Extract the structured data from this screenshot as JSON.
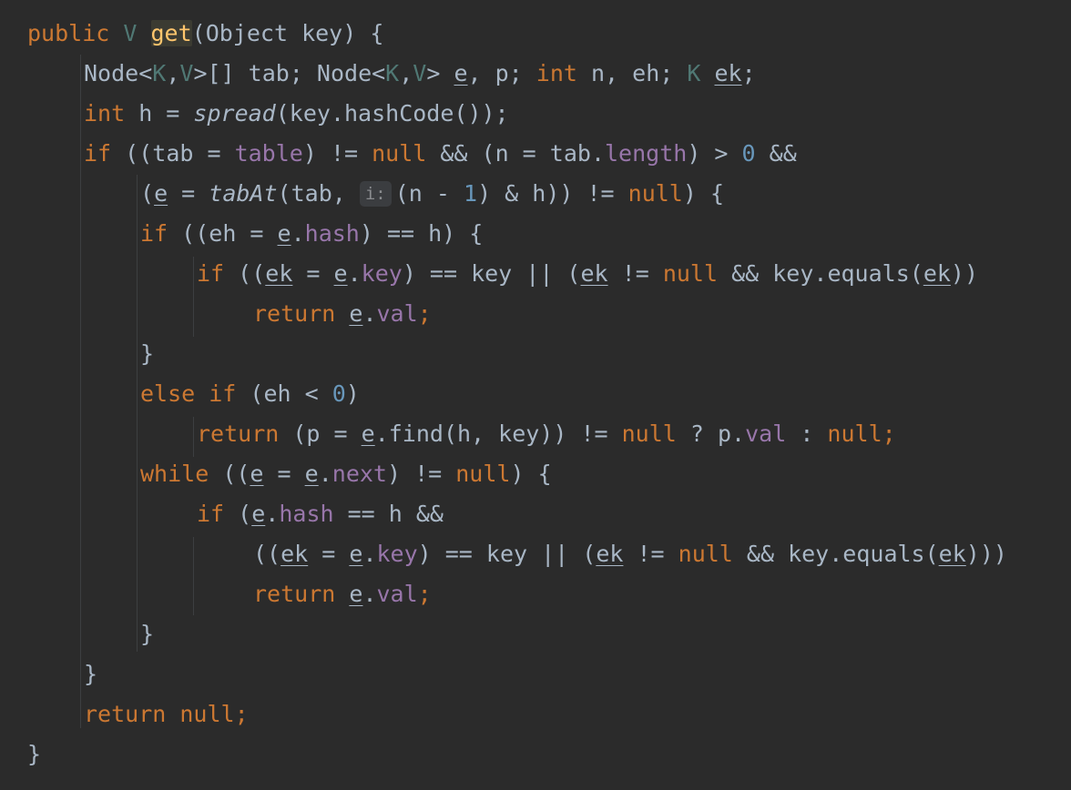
{
  "editor": {
    "language": "Java",
    "indent_spaces": 4,
    "gutter_char_offset": 0,
    "theme_colors": {
      "background": "#2b2b2b",
      "keyword": "#cc7832",
      "identifier": "#a9b7c6",
      "type_parameter": "#507874",
      "field": "#9876aa",
      "number": "#6897bb",
      "method_declaration": "#ffc66d",
      "inlay_hint_bg": "#3b3d40",
      "indent_guide": "#3d3f41"
    },
    "lines": [
      {
        "indent": 0,
        "tokens": [
          {
            "t": "public",
            "c": "kw"
          },
          {
            "t": " "
          },
          {
            "t": "V",
            "c": "tp"
          },
          {
            "t": " "
          },
          {
            "t": "get",
            "c": "hl"
          },
          {
            "t": "(Object key) {"
          }
        ]
      },
      {
        "indent": 1,
        "tokens": [
          {
            "t": "Node<"
          },
          {
            "t": "K",
            "c": "tp"
          },
          {
            "t": ","
          },
          {
            "t": "V",
            "c": "tp"
          },
          {
            "t": ">[] tab; Node<"
          },
          {
            "t": "K",
            "c": "tp"
          },
          {
            "t": ","
          },
          {
            "t": "V",
            "c": "tp"
          },
          {
            "t": "> "
          },
          {
            "t": "e",
            "c": "ul"
          },
          {
            "t": ", p; "
          },
          {
            "t": "int",
            "c": "kw"
          },
          {
            "t": " n, eh; "
          },
          {
            "t": "K",
            "c": "tp"
          },
          {
            "t": " "
          },
          {
            "t": "ek",
            "c": "ul"
          },
          {
            "t": ";"
          }
        ]
      },
      {
        "indent": 1,
        "tokens": [
          {
            "t": "int",
            "c": "kw"
          },
          {
            "t": " h = "
          },
          {
            "t": "spread",
            "c": "it"
          },
          {
            "t": "(key.hashCode());"
          }
        ]
      },
      {
        "indent": 1,
        "tokens": [
          {
            "t": "if",
            "c": "kw"
          },
          {
            "t": " ((tab = "
          },
          {
            "t": "table",
            "c": "fld"
          },
          {
            "t": ") != "
          },
          {
            "t": "null",
            "c": "kw"
          },
          {
            "t": " && (n = tab."
          },
          {
            "t": "length",
            "c": "fld"
          },
          {
            "t": ") > "
          },
          {
            "t": "0",
            "c": "num"
          },
          {
            "t": " &&"
          }
        ]
      },
      {
        "indent": 2,
        "tokens": [
          {
            "t": "("
          },
          {
            "t": "e",
            "c": "ul"
          },
          {
            "t": " = "
          },
          {
            "t": "tabAt",
            "c": "it"
          },
          {
            "t": "(tab, "
          },
          {
            "t": "i:",
            "c": "hint"
          },
          {
            "t": "(n - "
          },
          {
            "t": "1",
            "c": "num"
          },
          {
            "t": ") & h)) != "
          },
          {
            "t": "null",
            "c": "kw"
          },
          {
            "t": ") {"
          }
        ]
      },
      {
        "indent": 2,
        "tokens": [
          {
            "t": "if",
            "c": "kw"
          },
          {
            "t": " ((eh = "
          },
          {
            "t": "e",
            "c": "ul"
          },
          {
            "t": "."
          },
          {
            "t": "hash",
            "c": "fld"
          },
          {
            "t": ") == h) {"
          }
        ]
      },
      {
        "indent": 3,
        "tokens": [
          {
            "t": "if",
            "c": "kw"
          },
          {
            "t": " (("
          },
          {
            "t": "ek",
            "c": "ul"
          },
          {
            "t": " = "
          },
          {
            "t": "e",
            "c": "ul"
          },
          {
            "t": "."
          },
          {
            "t": "key",
            "c": "fld"
          },
          {
            "t": ") == key || ("
          },
          {
            "t": "ek",
            "c": "ul"
          },
          {
            "t": " != "
          },
          {
            "t": "null",
            "c": "kw"
          },
          {
            "t": " && key.equals("
          },
          {
            "t": "ek",
            "c": "ul"
          },
          {
            "t": "))"
          }
        ]
      },
      {
        "indent": 4,
        "tokens": [
          {
            "t": "return",
            "c": "kw"
          },
          {
            "t": " "
          },
          {
            "t": "e",
            "c": "ul"
          },
          {
            "t": "."
          },
          {
            "t": "val",
            "c": "fld"
          },
          {
            "t": ";",
            "c": "kw"
          }
        ]
      },
      {
        "indent": 2,
        "tokens": [
          {
            "t": "}"
          }
        ]
      },
      {
        "indent": 2,
        "tokens": [
          {
            "t": "else if",
            "c": "kw"
          },
          {
            "t": " (eh < "
          },
          {
            "t": "0",
            "c": "num"
          },
          {
            "t": ")"
          }
        ]
      },
      {
        "indent": 3,
        "tokens": [
          {
            "t": "return",
            "c": "kw"
          },
          {
            "t": " (p = "
          },
          {
            "t": "e",
            "c": "ul"
          },
          {
            "t": ".find(h, key)) != "
          },
          {
            "t": "null",
            "c": "kw"
          },
          {
            "t": " ? p."
          },
          {
            "t": "val",
            "c": "fld"
          },
          {
            "t": " : "
          },
          {
            "t": "null",
            "c": "kw"
          },
          {
            "t": ";",
            "c": "kw"
          }
        ]
      },
      {
        "indent": 2,
        "tokens": [
          {
            "t": "while",
            "c": "kw"
          },
          {
            "t": " (("
          },
          {
            "t": "e",
            "c": "ul"
          },
          {
            "t": " = "
          },
          {
            "t": "e",
            "c": "ul"
          },
          {
            "t": "."
          },
          {
            "t": "next",
            "c": "fld"
          },
          {
            "t": ") != "
          },
          {
            "t": "null",
            "c": "kw"
          },
          {
            "t": ") {"
          }
        ]
      },
      {
        "indent": 3,
        "tokens": [
          {
            "t": "if",
            "c": "kw"
          },
          {
            "t": " ("
          },
          {
            "t": "e",
            "c": "ul"
          },
          {
            "t": "."
          },
          {
            "t": "hash",
            "c": "fld"
          },
          {
            "t": " == h &&"
          }
        ]
      },
      {
        "indent": 4,
        "tokens": [
          {
            "t": "(("
          },
          {
            "t": "ek",
            "c": "ul"
          },
          {
            "t": " = "
          },
          {
            "t": "e",
            "c": "ul"
          },
          {
            "t": "."
          },
          {
            "t": "key",
            "c": "fld"
          },
          {
            "t": ") == key || ("
          },
          {
            "t": "ek",
            "c": "ul"
          },
          {
            "t": " != "
          },
          {
            "t": "null",
            "c": "kw"
          },
          {
            "t": " && key.equals("
          },
          {
            "t": "ek",
            "c": "ul"
          },
          {
            "t": ")))"
          }
        ]
      },
      {
        "indent": 4,
        "tokens": [
          {
            "t": "return",
            "c": "kw"
          },
          {
            "t": " "
          },
          {
            "t": "e",
            "c": "ul"
          },
          {
            "t": "."
          },
          {
            "t": "val",
            "c": "fld"
          },
          {
            "t": ";",
            "c": "kw"
          }
        ]
      },
      {
        "indent": 2,
        "tokens": [
          {
            "t": "}"
          }
        ]
      },
      {
        "indent": 1,
        "tokens": [
          {
            "t": "}"
          }
        ]
      },
      {
        "indent": 1,
        "tokens": [
          {
            "t": "return",
            "c": "kw"
          },
          {
            "t": " "
          },
          {
            "t": "null",
            "c": "kw"
          },
          {
            "t": ";",
            "c": "kw"
          }
        ]
      },
      {
        "indent": 0,
        "tokens": [
          {
            "t": "}"
          }
        ]
      }
    ]
  }
}
